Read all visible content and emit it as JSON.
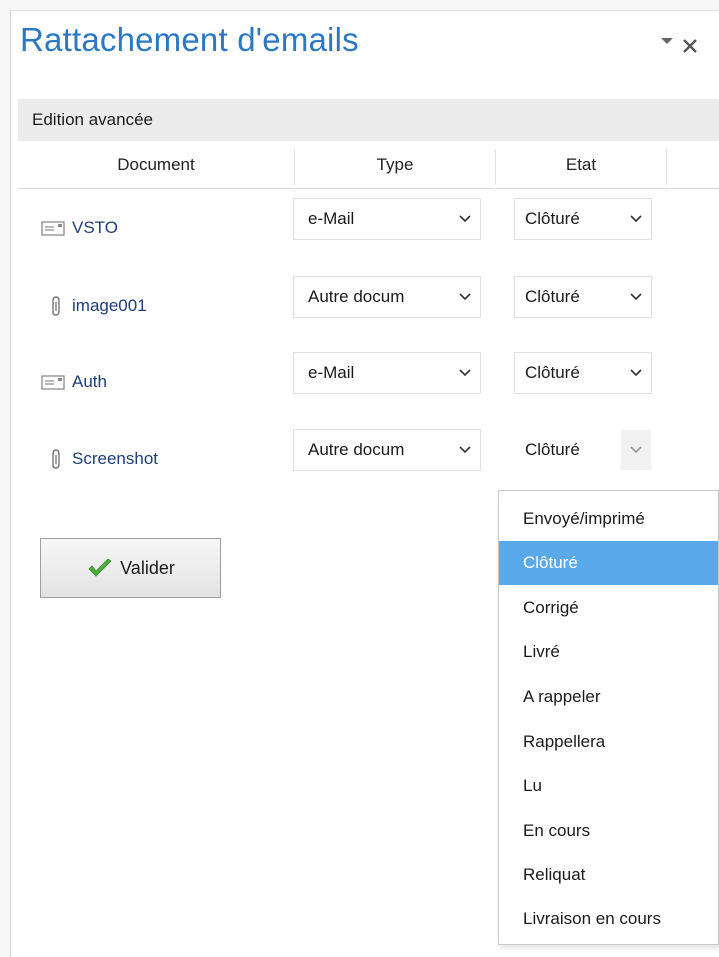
{
  "pane": {
    "title": "Rattachement d'emails",
    "section_label": "Edition avancée"
  },
  "columns": {
    "document": "Document",
    "type": "Type",
    "etat": "Etat"
  },
  "rows": [
    {
      "icon": "email-icon",
      "document": "VSTO",
      "type": "e-Mail",
      "etat": "Clôturé"
    },
    {
      "icon": "paperclip-icon",
      "document": "image001",
      "type": "Autre docum",
      "etat": "Clôturé"
    },
    {
      "icon": "email-icon",
      "document": "Auth",
      "type": "e-Mail",
      "etat": "Clôturé"
    },
    {
      "icon": "paperclip-icon",
      "document": "Screenshot",
      "type": "Autre docum",
      "etat": "Clôturé"
    }
  ],
  "buttons": {
    "valider": "Valider"
  },
  "etat_dropdown": {
    "selected": "Clôturé",
    "options": [
      "Envoyé/imprimé",
      "Clôturé",
      "Corrigé",
      "Livré",
      "A rappeler",
      "Rappellera",
      "Lu",
      "En cours",
      "Reliquat",
      "Livraison en cours"
    ]
  },
  "colors": {
    "title": "#2b79c2",
    "selection": "#5aa9ea",
    "document_link": "#1f3d7a",
    "check": "#4caf3c"
  }
}
